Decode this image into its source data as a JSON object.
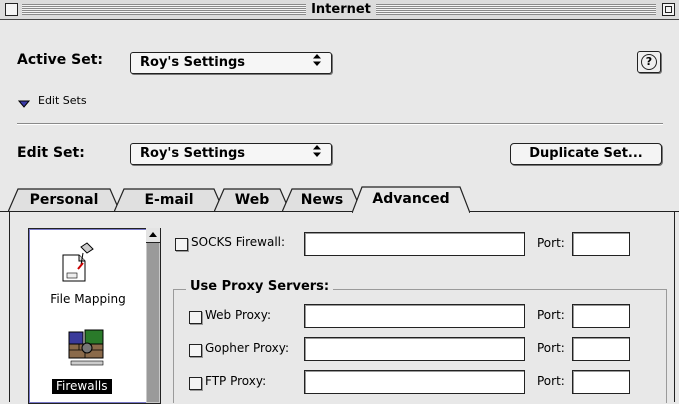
{
  "window": {
    "title": "Internet"
  },
  "active_set": {
    "label": "Active Set:",
    "value": "Roy's Settings"
  },
  "help_button": {
    "label": "?"
  },
  "edit_sets": {
    "label": "Edit Sets"
  },
  "edit_set": {
    "label": "Edit Set:",
    "value": "Roy's Settings"
  },
  "duplicate_button": {
    "label": "Duplicate Set..."
  },
  "popup_arrows": "⬍",
  "tabs": [
    {
      "label": "Personal"
    },
    {
      "label": "E-mail"
    },
    {
      "label": "Web"
    },
    {
      "label": "News"
    },
    {
      "label": "Advanced",
      "selected": true
    }
  ],
  "icon_list": [
    {
      "label": "File Mapping",
      "icon": "file-mapping-icon"
    },
    {
      "label": "Firewalls",
      "icon": "firewalls-icon",
      "selected": true
    }
  ],
  "socks": {
    "label": "SOCKS Firewall:",
    "value": "",
    "port_label": "Port:",
    "port": ""
  },
  "proxy_group": {
    "title": "Use Proxy Servers:",
    "rows": [
      {
        "label": "Web Proxy:",
        "value": "",
        "port_label": "Port:",
        "port": ""
      },
      {
        "label": "Gopher Proxy:",
        "value": "",
        "port_label": "Port:",
        "port": ""
      },
      {
        "label": "FTP Proxy:",
        "value": "",
        "port_label": "Port:",
        "port": ""
      }
    ]
  },
  "colors": {
    "selection": "#000000",
    "list_focus": "#7878c8",
    "edit_sets_triangle": "#3a3aa8"
  }
}
